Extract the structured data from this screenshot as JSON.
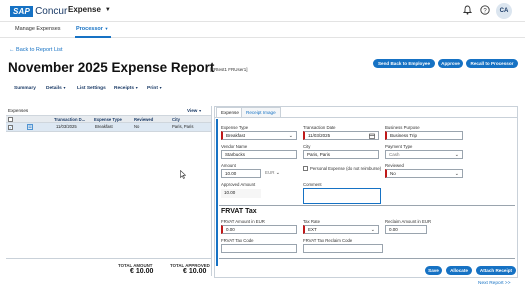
{
  "topbar": {
    "logo_sap": "SAP",
    "logo_concur": "Concur",
    "app": "Expense",
    "avatar": "CA"
  },
  "nav": {
    "manage": "Manage Expenses",
    "processor": "Processor"
  },
  "header": {
    "back": "Back to Report List",
    "title": "November 2025 Expense Report",
    "subtitle": "[FRtest1 FRUser1]",
    "buttons": {
      "send_back": "Send Back to Employee",
      "approve": "Approve",
      "recall": "Recall to Processor"
    }
  },
  "menus": {
    "summary": "Summary",
    "details": "Details",
    "list_settings": "List Settings",
    "receipts": "Receipts",
    "print": "Print"
  },
  "list": {
    "label": "Expenses",
    "view": "View",
    "columns": [
      "Transaction D...",
      "Expense Type",
      "Reviewed",
      "City"
    ],
    "row": {
      "date": "11/03/2025",
      "type": "Breakfast",
      "reviewed": "No",
      "city": "Paris, Paris"
    },
    "total_amount_label": "TOTAL AMOUNT",
    "total_amount": "€ 10.00",
    "total_approved_label": "TOTAL APPROVED",
    "total_approved": "€ 10.00"
  },
  "tabs": {
    "expense": "Expense",
    "receipt": "Receipt Image"
  },
  "form": {
    "expense_type_label": "Expense Type",
    "expense_type": "Breakfast",
    "transaction_date_label": "Transaction Date",
    "transaction_date": "11/03/2025",
    "business_purpose_label": "Business Purpose",
    "business_purpose": "Business Trip",
    "vendor_label": "Vendor Name",
    "vendor": "Starbucks",
    "city_label": "City",
    "city": "Paris, Paris",
    "payment_label": "Payment Type",
    "payment": "Cash",
    "amount_label": "Amount",
    "amount": "10.00",
    "currency": "EUR",
    "personal_label": "Personal Expense (do not reimburse)",
    "reviewed_label": "Reviewed",
    "reviewed": "No",
    "approved_label": "Approved Amount",
    "approved": "10.00",
    "comment_label": "Comment",
    "comment": ""
  },
  "frvat": {
    "title": "FRVAT Tax",
    "amount_label": "FRVAT Amount in EUR",
    "amount": "0.00",
    "rate_label": "Tax Rate",
    "rate": "EXT",
    "reclaim_label": "Reclaim Amount in EUR",
    "reclaim": "0.00",
    "code_label": "FRVAT Tax Code",
    "code": "",
    "reclaim_code_label": "FRVAT Tax Reclaim Code",
    "reclaim_code": ""
  },
  "actions": {
    "save": "Save",
    "allocate": "Allocate",
    "attach": "Attach Receipt",
    "next": "Next Report >>"
  },
  "colors": {
    "accent": "#1672c4",
    "required": "#c01818"
  },
  "icons": {
    "bell": "bell-icon",
    "help": "help-icon",
    "calendar": "calendar-icon",
    "receipt": "receipt-icon"
  }
}
